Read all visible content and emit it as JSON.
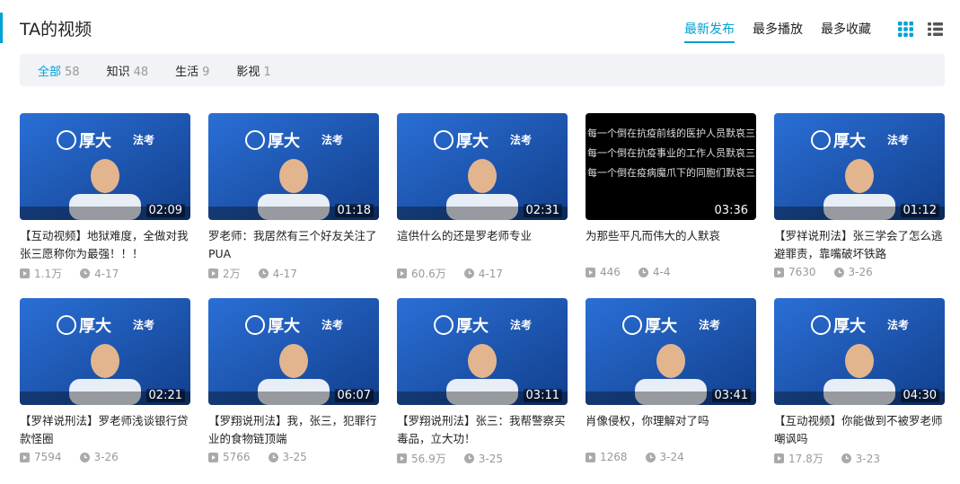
{
  "header": {
    "title": "TA的视频"
  },
  "sort_tabs": [
    {
      "label": "最新发布",
      "active": true
    },
    {
      "label": "最多播放",
      "active": false
    },
    {
      "label": "最多收藏",
      "active": false
    }
  ],
  "view_icons": [
    "grid-view-icon",
    "list-view-icon"
  ],
  "filters": [
    {
      "label": "全部",
      "count": "58",
      "active": true
    },
    {
      "label": "知识",
      "count": "48",
      "active": false
    },
    {
      "label": "生活",
      "count": "9",
      "active": false
    },
    {
      "label": "影视",
      "count": "1",
      "active": false
    }
  ],
  "colors": {
    "accent": "#00a1d6",
    "thumb_blue": "#1e5bb8",
    "thumb_black": "#000000"
  },
  "videos": [
    {
      "title": "【互动视频】地狱难度，全做对我张三愿称你为最强！！！",
      "duration": "02:09",
      "plays": "1.1万",
      "date": "4-17",
      "style": "blue"
    },
    {
      "title": "罗老师：我居然有三个好友关注了PUA",
      "duration": "01:18",
      "plays": "2万",
      "date": "4-17",
      "style": "blue"
    },
    {
      "title": "這供什么的还是罗老师专业",
      "duration": "02:31",
      "plays": "60.6万",
      "date": "4-17",
      "style": "blue"
    },
    {
      "title": "为那些平凡而伟大的人默哀",
      "duration": "03:36",
      "plays": "446",
      "date": "4-4",
      "style": "black"
    },
    {
      "title": "【罗祥说刑法】张三学会了怎么逃避罪责，靠嘴破坏铁路",
      "duration": "01:12",
      "plays": "7630",
      "date": "3-26",
      "style": "blue"
    },
    {
      "title": "【罗祥说刑法】罗老师浅谈银行贷款怪圈",
      "duration": "02:21",
      "plays": "7594",
      "date": "3-26",
      "style": "blue"
    },
    {
      "title": "【罗翔说刑法】我，张三，犯罪行业的食物链顶端",
      "duration": "06:07",
      "plays": "5766",
      "date": "3-25",
      "style": "blue"
    },
    {
      "title": "【罗翔说刑法】张三：我帮警察买毒品，立大功！",
      "duration": "03:11",
      "plays": "56.9万",
      "date": "3-25",
      "style": "blue"
    },
    {
      "title": "肖像侵权，你理解对了吗",
      "duration": "03:41",
      "plays": "1268",
      "date": "3-24",
      "style": "blue"
    },
    {
      "title": "【互动视频】你能做到不被罗老师嘲讽吗",
      "duration": "04:30",
      "plays": "17.8万",
      "date": "3-23",
      "style": "blue"
    }
  ],
  "thumb_logo_text": "法考",
  "black_thumb_lines": [
    "每一个倒在抗疫前线的医护人员默哀三分钟",
    "每一个倒在抗疫事业的工作人员默哀三分钟",
    "每一个倒在疫病魔爪下的同胞们默哀三分钟"
  ]
}
